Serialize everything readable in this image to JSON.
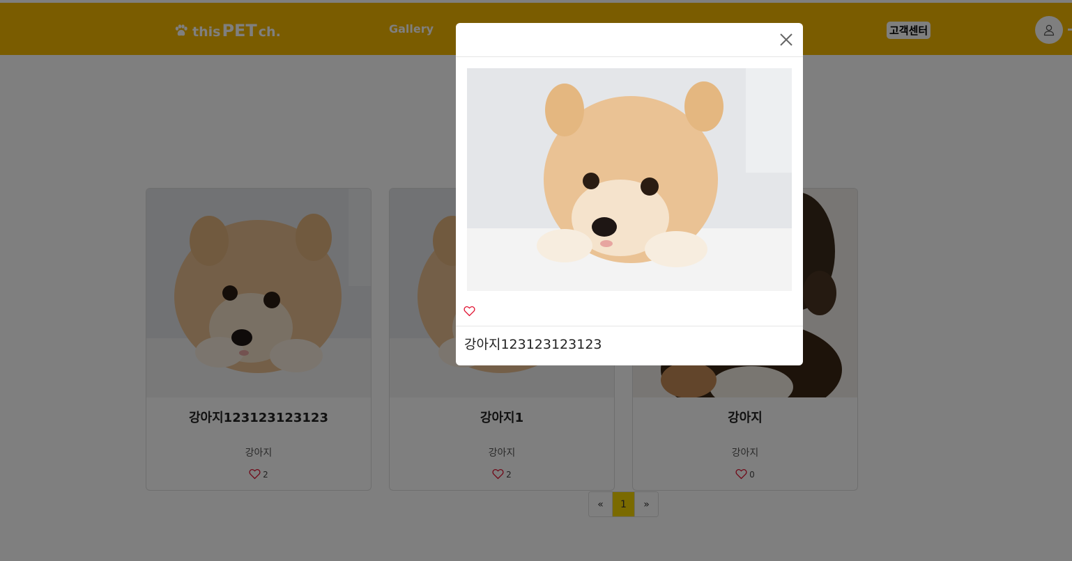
{
  "brand": {
    "part1": "this",
    "part2": "PET",
    "part3": " ch."
  },
  "nav": {
    "gallery": "Gallery",
    "support": "고객센터"
  },
  "cards": [
    {
      "title": "강아지123123123123",
      "subtitle": "강아지",
      "likes": "2"
    },
    {
      "title": "강아지1",
      "subtitle": "강아지",
      "likes": "2"
    },
    {
      "title": "강아지",
      "subtitle": "강아지",
      "likes": "0"
    }
  ],
  "pagination": {
    "prev": "«",
    "current": "1",
    "next": "»"
  },
  "modal": {
    "caption": "강아지123123123123"
  },
  "colors": {
    "navbar": "#f5b800",
    "heart": "#e0102f",
    "active_page": "#f5d400"
  },
  "icons": [
    "paw-icon",
    "user-icon",
    "heart-icon",
    "close-icon"
  ]
}
